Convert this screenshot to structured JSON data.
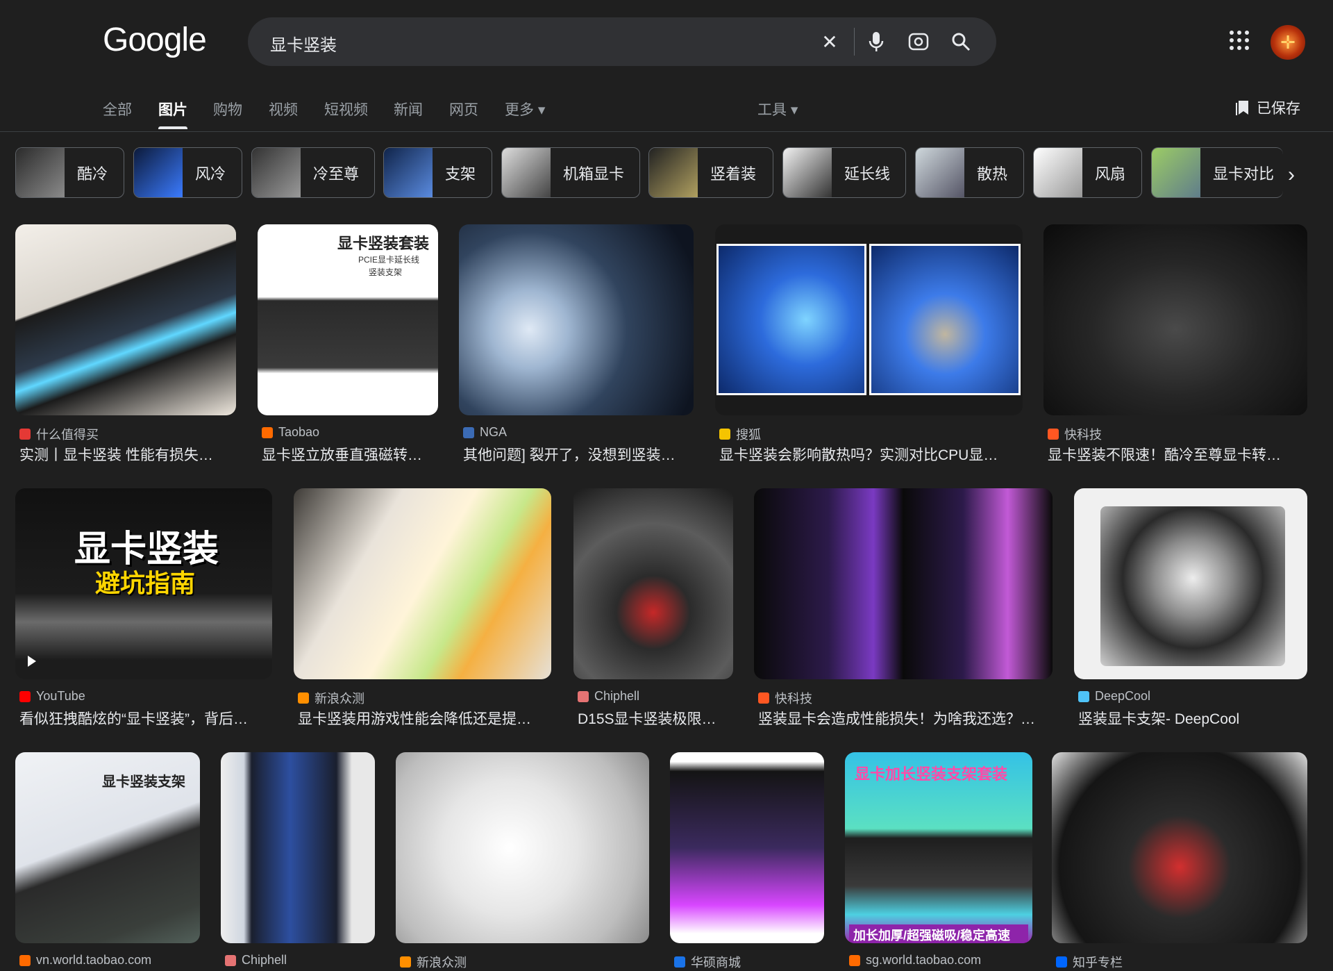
{
  "header": {
    "logo": "Google",
    "query": "显卡竖装",
    "saved_label": "已保存"
  },
  "tabs": [
    "全部",
    "图片",
    "购物",
    "视频",
    "短视频",
    "新闻",
    "网页",
    "更多 ▾"
  ],
  "tools_label": "工具 ▾",
  "chips": [
    "酷冷",
    "风冷",
    "冷至尊",
    "支架",
    "机箱显卡",
    "竖着装",
    "延长线",
    "散热",
    "风扇",
    "显卡对比"
  ],
  "results": [
    {
      "source": "什么值得买",
      "title": "实测丨显卡竖装 性能有损失…",
      "fav": "#e53935"
    },
    {
      "source": "Taobao",
      "title": "显卡竖立放垂直强磁转…",
      "fav": "#ff6a00",
      "overlay": "显卡竖装套装",
      "overlay_sub": "PCIE显卡延长线",
      "overlay_sub2": "竖装支架"
    },
    {
      "source": "NGA",
      "title": "其他问题] 裂开了，没想到竖装…",
      "fav": "#3b6bb5"
    },
    {
      "source": "搜狐",
      "title": "显卡竖装会影响散热吗？实测对比CPU显…",
      "fav": "#f5c400"
    },
    {
      "source": "快科技",
      "title": "显卡竖装不限速！酷冷至尊显卡转…",
      "fav": "#ff5722"
    },
    {
      "source": "YouTube",
      "title": "看似狂拽酷炫的“显卡竖装”，背后…",
      "fav": "#ff0000",
      "overlay": "显卡竖装",
      "overlay_sub": "避坑指南"
    },
    {
      "source": "新浪众测",
      "title": "显卡竖装用游戏性能会降低还是提…",
      "fav": "#ff8f00"
    },
    {
      "source": "Chiphell",
      "title": "D15S显卡竖装极限…",
      "fav": "#e57373"
    },
    {
      "source": "快科技",
      "title": "竖装显卡会造成性能损失！为啥我还选？…",
      "fav": "#ff5722"
    },
    {
      "source": "DeepCool",
      "title": "竖装显卡支架- DeepCool",
      "fav": "#4fc3f7"
    },
    {
      "source": "vn.world.taobao.com",
      "title": "",
      "fav": "#ff6a00",
      "overlay": "显卡竖装支架"
    },
    {
      "source": "Chiphell",
      "title": "",
      "fav": "#e57373"
    },
    {
      "source": "新浪众测",
      "title": "",
      "fav": "#ff8f00"
    },
    {
      "source": "华硕商城",
      "title": "",
      "fav": "#1a73e8"
    },
    {
      "source": "sg.world.taobao.com",
      "title": "",
      "fav": "#ff6a00",
      "overlay": "显卡加长竖装支架套装",
      "overlay_sub": "加长加厚/超强磁吸/稳定高速"
    },
    {
      "source": "知乎专栏",
      "title": "",
      "fav": "#0066ff"
    }
  ]
}
